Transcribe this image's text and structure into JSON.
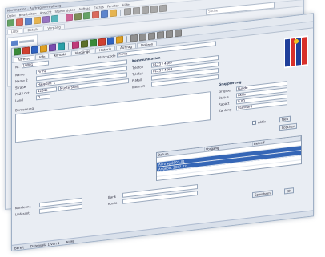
{
  "back_window": {
    "title": "Kommission - Auftragsverwaltung",
    "menu": [
      "Datei",
      "Bearbeiten",
      "Ansicht",
      "Stammdaten",
      "Auftrag",
      "Extras",
      "Fenster",
      "Hilfe"
    ],
    "tabs": [
      "Liste",
      "Details",
      "Vorgang"
    ],
    "search_placeholder": "Suche",
    "toolbar_colors": [
      "#3a8a3a",
      "#d04030",
      "#2f62c0",
      "#e0a020",
      "#7a4cb0",
      "#2aa0a8",
      "#c03a7a",
      "#5c6f2a",
      "#3a8a3a",
      "#d04030",
      "#2f62c0",
      "#e0a020",
      "#909090",
      "#909090",
      "#909090",
      "#909090",
      "#909090"
    ]
  },
  "front_window": {
    "tabs": [
      "Adresse",
      "Info",
      "Kontakt",
      "Vorgänge",
      "Historie",
      "Auftrag",
      "Notizen"
    ],
    "toolbar_colors": [
      "#3a8a3a",
      "#d04030",
      "#2f62c0",
      "#e0a020",
      "#7a4cb0",
      "#2aa0a8",
      "#c03a7a",
      "#5c6f2a",
      "#3a8a3a",
      "#d04030",
      "#2f62c0",
      "#e0a020",
      "#909090",
      "#909090",
      "#909090",
      "#909090",
      "#909090",
      "#909090"
    ],
    "header": {
      "nr_label": "Nr.",
      "nr_value": "10001",
      "match_label": "Matchcode",
      "match_value": "Firma"
    },
    "address": {
      "name_label": "Name",
      "name_value": "Firma",
      "name2_label": "Name 2",
      "name2_value": "",
      "street_label": "Straße",
      "street_value": "Hauptstr. 1",
      "plz_label": "PLZ / Ort",
      "plz_value": "12345",
      "city_value": "Musterstadt",
      "country_label": "Land",
      "country_value": "D"
    },
    "contact": {
      "section": "Kommunikation",
      "phone_label": "Telefon",
      "phone_value": "0123 / 4567",
      "fax_label": "Telefax",
      "fax_value": "0123 / 4568",
      "mail_label": "E-Mail",
      "mail_value": "",
      "web_label": "Internet",
      "web_value": ""
    },
    "group": {
      "section": "Gruppierung",
      "g1_label": "Gruppe",
      "g1_value": "Kunde",
      "g2_label": "Status",
      "g2_value": "Aktiv",
      "g3_label": "Rabatt",
      "g3_value": "0,00",
      "g4_label": "Zahlung",
      "g4_value": "Standard"
    },
    "notes_label": "Bemerkung",
    "grid": {
      "headers": [
        "Datum",
        "Vorgang",
        "Betreff"
      ],
      "rows": [
        "",
        "Auftrag 2007-01",
        "Angebot 2007-02",
        ""
      ]
    },
    "buttons": {
      "new": "Neu",
      "delete": "Löschen",
      "save": "Speichern",
      "ok": "OK"
    },
    "checkbox_label": "Aktiv",
    "lower": {
      "a_label": "Kundennr.",
      "a_value": "",
      "b_label": "Lieferant",
      "b_value": "",
      "c_label": "Bank",
      "c_value": "",
      "d_label": "Konto",
      "d_value": ""
    },
    "status": [
      "Bereit",
      "Datensatz 1 von 1",
      "NUM"
    ]
  }
}
